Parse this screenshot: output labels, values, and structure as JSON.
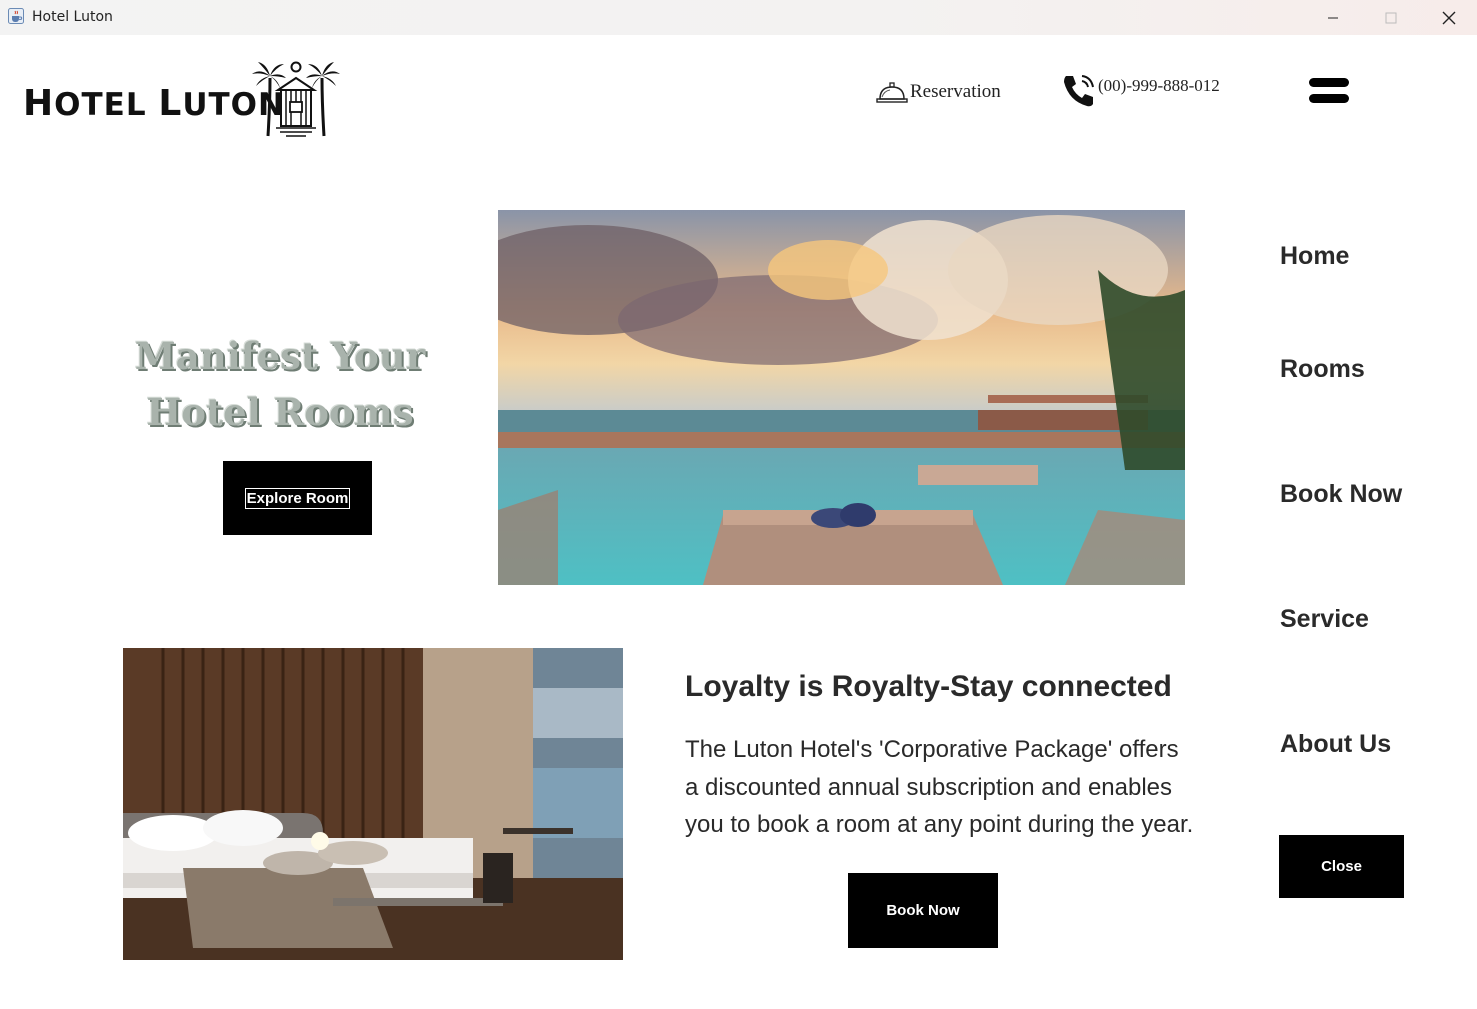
{
  "window": {
    "title": "Hotel Luton",
    "controls": [
      "minimize",
      "maximize",
      "close"
    ]
  },
  "header": {
    "logo_text_big1": "H",
    "logo_text_small1": "OTEL ",
    "logo_text_big2": "L",
    "logo_text_small2": "UTON",
    "reservation_label": "Reservation",
    "phone_label": "(00)-999-888-012"
  },
  "hero": {
    "title_line1": "Manifest Your",
    "title_line2": "Hotel Rooms",
    "explore_label": "Explore Room"
  },
  "loyalty": {
    "heading": "Loyalty is Royalty-Stay connected",
    "body": "The Luton Hotel's 'Corporative Package' offers\na discounted annual subscription and enables\n you to book a room at any point during the year.",
    "book_label": "Book Now"
  },
  "side_menu": {
    "items": [
      {
        "label": "Home"
      },
      {
        "label": "Rooms"
      },
      {
        "label": "Book Now"
      },
      {
        "label": "Service"
      },
      {
        "label": "About Us"
      }
    ],
    "close_label": "Close"
  },
  "icons": {
    "app": "java-cup-icon",
    "reservation": "service-bell-icon",
    "phone": "phone-icon",
    "menu": "hamburger-icon"
  }
}
